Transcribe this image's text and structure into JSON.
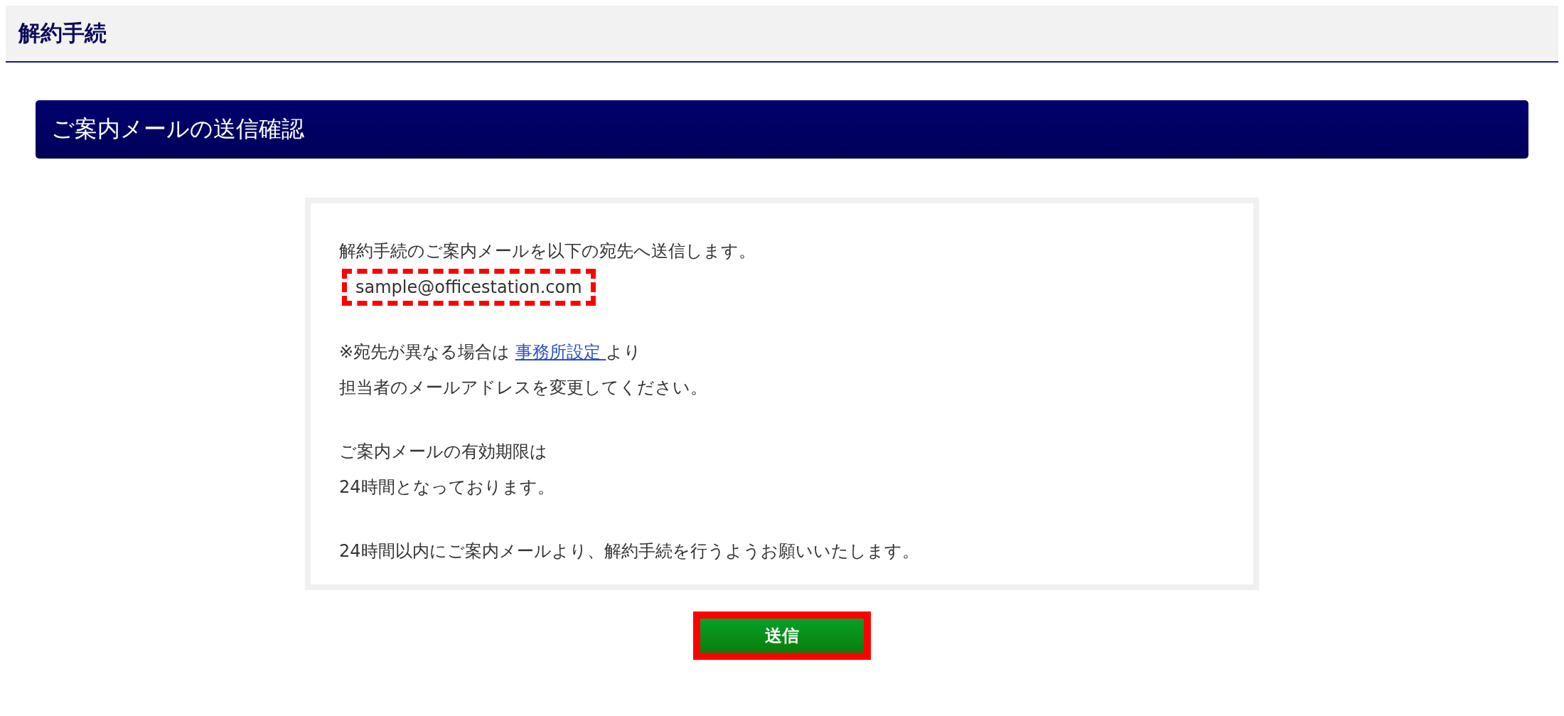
{
  "page_title": "解約手続",
  "section_title": "ご案内メールの送信確認",
  "message": {
    "intro": "解約手続のご案内メールを以下の宛先へ送信します。",
    "email": "sample@officestation.com",
    "note_prefix": "※宛先が異なる場合は",
    "note_link": "事務所設定",
    "note_suffix": "より",
    "note_line2": "担当者のメールアドレスを変更してください。",
    "expiry_line1": "ご案内メールの有効期限は",
    "expiry_line2": "24時間となっております。",
    "request": "24時間以内にご案内メールより、解約手続を行うようお願いいたします。"
  },
  "send_button": {
    "label": "送信"
  }
}
